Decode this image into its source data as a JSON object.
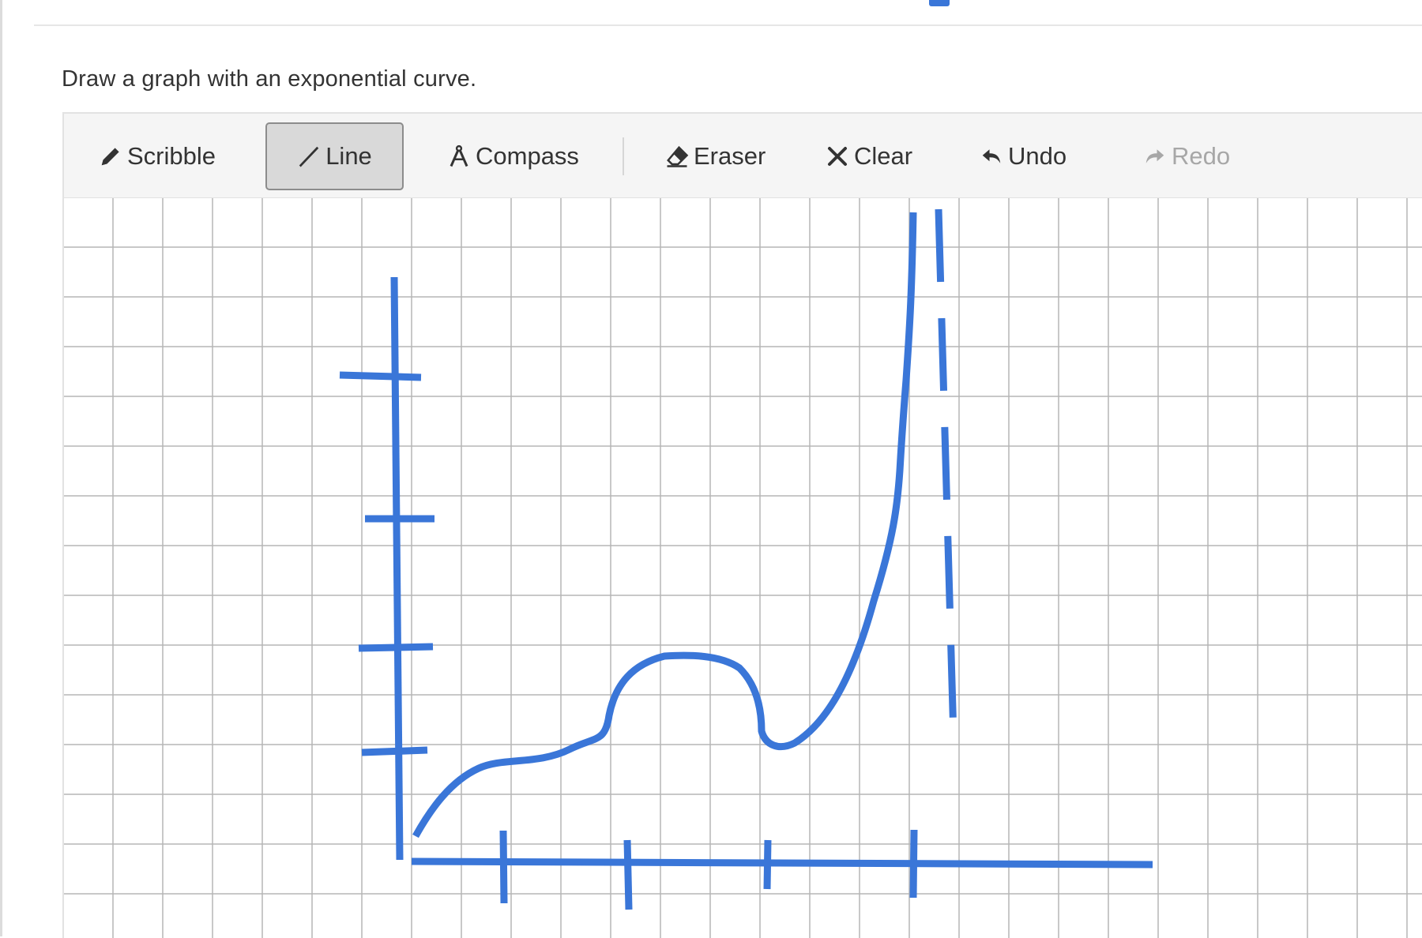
{
  "question": {
    "prompt": "Draw a graph with an exponential curve."
  },
  "toolbar": {
    "tools": [
      {
        "id": "scribble",
        "label": "Scribble",
        "icon": "pencil-icon",
        "active": false,
        "enabled": true
      },
      {
        "id": "line",
        "label": "Line",
        "icon": "line-icon",
        "active": true,
        "enabled": true
      },
      {
        "id": "compass",
        "label": "Compass",
        "icon": "compass-icon",
        "active": false,
        "enabled": true
      },
      {
        "id": "eraser",
        "label": "Eraser",
        "icon": "eraser-icon",
        "active": false,
        "enabled": true
      },
      {
        "id": "clear",
        "label": "Clear",
        "icon": "close-icon",
        "active": false,
        "enabled": true
      },
      {
        "id": "undo",
        "label": "Undo",
        "icon": "undo-icon",
        "active": false,
        "enabled": true
      },
      {
        "id": "redo",
        "label": "Redo",
        "icon": "redo-icon",
        "active": false,
        "enabled": false
      }
    ]
  },
  "canvas": {
    "grid": true,
    "grid_color": "#b5b5b5",
    "stroke_color": "#3a76d8"
  },
  "colors": {
    "accent": "#3a76d8",
    "toolbar_bg": "#f5f5f5",
    "active_tool_bg": "#d9d9d9",
    "disabled_text": "#a7a7a7"
  }
}
